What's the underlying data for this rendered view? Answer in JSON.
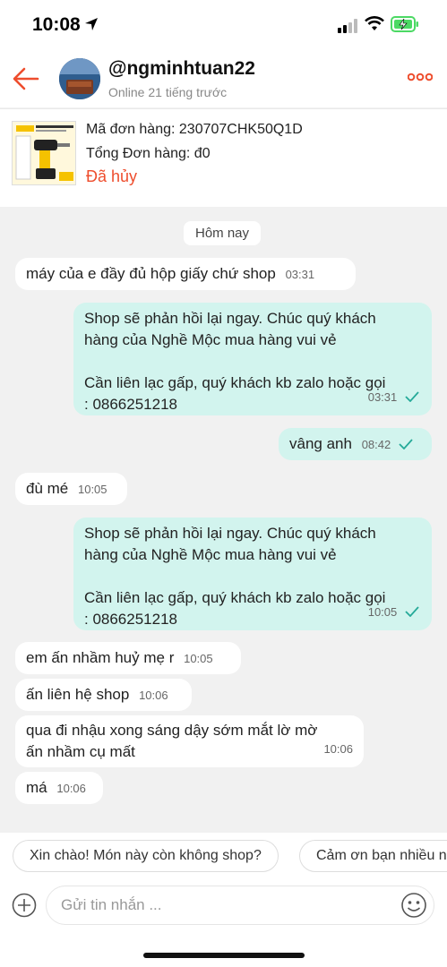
{
  "status_bar": {
    "time": "10:08"
  },
  "header": {
    "username": "@ngminhtuan22",
    "status": "Online 21 tiếng trước"
  },
  "order": {
    "id_label": "Mã đơn hàng: 230707CHK50Q1D",
    "total_label": "Tổng Đơn hàng: đ0",
    "status": "Đã hủy"
  },
  "chat": {
    "day_label": "Hôm nay",
    "messages": [
      {
        "text": "máy của e đầy đủ hộp giấy chứ shop",
        "time": "03:31"
      },
      {
        "text": "Shop sẽ phản hồi lại ngay. Chúc quý khách\nhàng của Nghề Mộc mua hàng vui vẻ\n\nCần liên lạc gấp, quý khách kb zalo hoặc gọi\n: 0866251218",
        "time": "03:31"
      },
      {
        "text": "vâng anh",
        "time": "08:42"
      },
      {
        "text": "đù mé",
        "time": "10:05"
      },
      {
        "text": "Shop sẽ phản hồi lại ngay. Chúc quý khách\nhàng của Nghề Mộc mua hàng vui vẻ\n\nCần liên lạc gấp, quý khách kb zalo hoặc gọi\n: 0866251218",
        "time": "10:05"
      },
      {
        "text": "em ấn nhầm huỷ mẹ r",
        "time": "10:05"
      },
      {
        "text": "ấn liên hệ shop",
        "time": "10:06"
      },
      {
        "text": "qua đi nhậu xong sáng dậy sớm mắt lờ mờ\nấn nhầm cụ mất",
        "time": "10:06"
      },
      {
        "text": "má",
        "time": "10:06"
      }
    ]
  },
  "suggestions": [
    "Xin chào! Món này còn không shop?",
    "Cảm ơn bạn nhiều n"
  ],
  "input": {
    "placeholder": "Gửi tin nhắn ..."
  },
  "colors": {
    "accent": "#ee4d2d",
    "outgoing_bubble": "#d2f4ee",
    "incoming_bubble": "#ffffff",
    "read_check": "#26aa99"
  }
}
